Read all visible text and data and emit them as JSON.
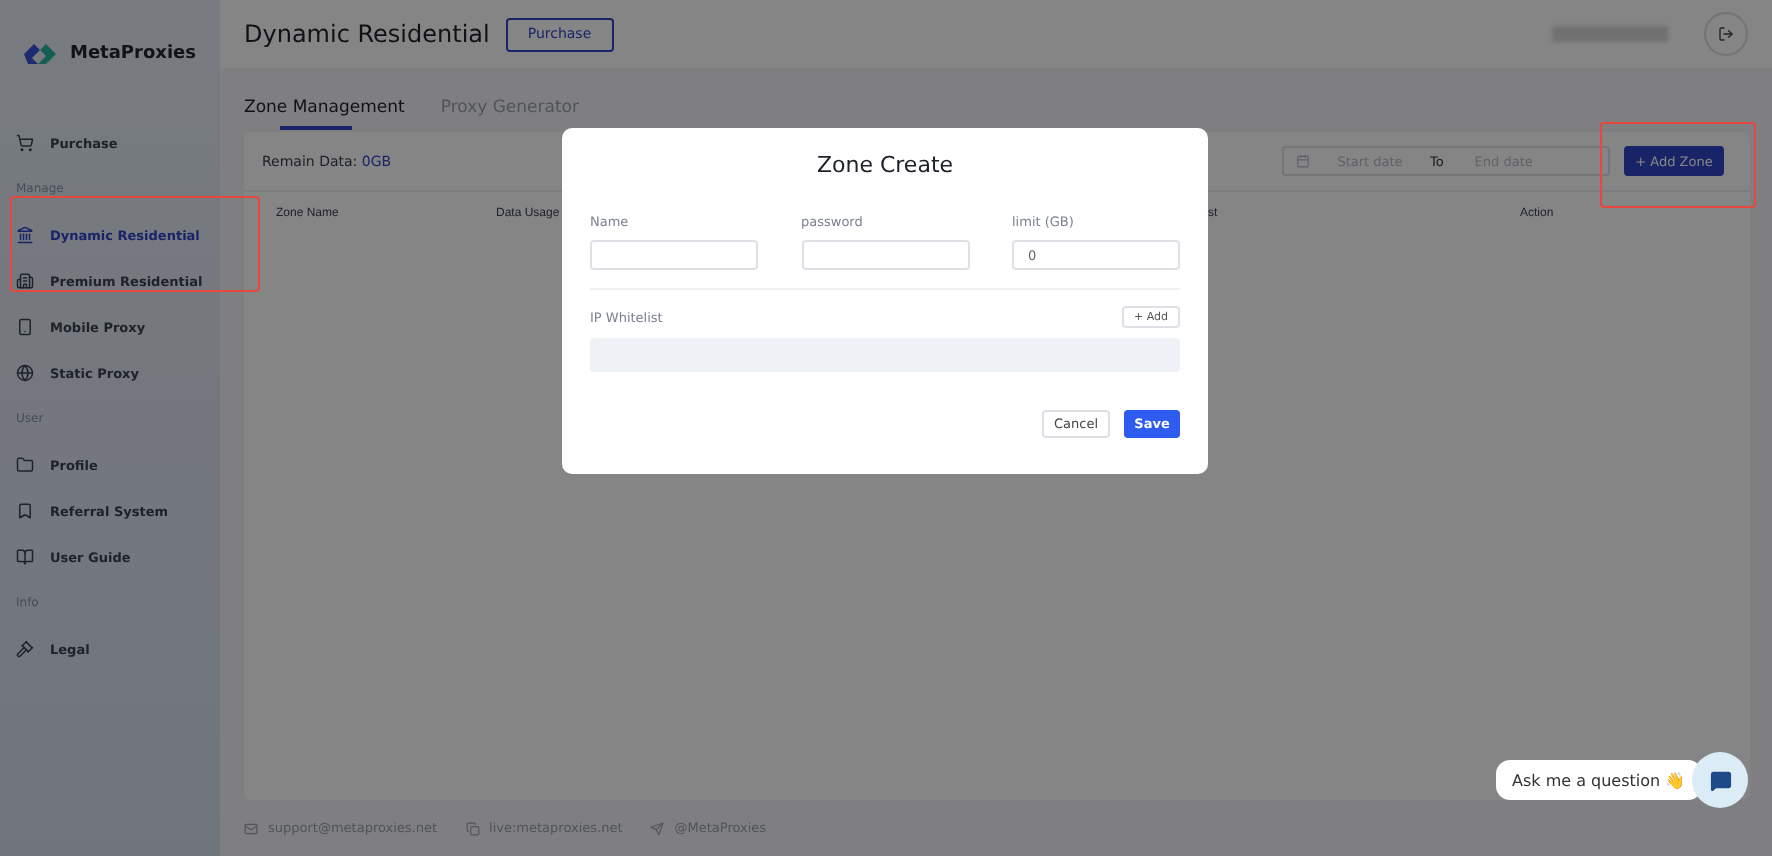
{
  "brand": "MetaProxies",
  "sidebar": [
    {
      "kind": "item",
      "label": "Purchase",
      "selected": false
    },
    {
      "kind": "heading",
      "label": "Manage"
    },
    {
      "kind": "item",
      "label": "Dynamic Residential",
      "selected": true
    },
    {
      "kind": "item",
      "label": "Premium Residential",
      "selected": false
    },
    {
      "kind": "item",
      "label": "Mobile Proxy",
      "selected": false
    },
    {
      "kind": "item",
      "label": "Static Proxy",
      "selected": false
    },
    {
      "kind": "heading",
      "label": "User"
    },
    {
      "kind": "item",
      "label": "Profile",
      "selected": false
    },
    {
      "kind": "item",
      "label": "Referral System",
      "selected": false
    },
    {
      "kind": "item",
      "label": "User Guide",
      "selected": false
    },
    {
      "kind": "heading",
      "label": "Info"
    },
    {
      "kind": "item",
      "label": "Legal",
      "selected": false
    }
  ],
  "header": {
    "title": "Dynamic Residential",
    "button": "Purchase"
  },
  "tabs": [
    {
      "label": "Zone Management",
      "selected": true
    },
    {
      "label": "Proxy Generator",
      "selected": false
    }
  ],
  "remain": {
    "label": "Remain Data:",
    "value": "0GB"
  },
  "date_range": {
    "start_placeholder": "Start date",
    "separator": "To",
    "end_placeholder": "End date"
  },
  "add_zone": "+ Add Zone",
  "table": {
    "columns": [
      "Zone Name",
      "Data Usage",
      "st",
      "Action"
    ]
  },
  "footer": [
    "support@metaproxies.net",
    "live:metaproxies.net",
    "@MetaProxies"
  ],
  "dialog": {
    "title": "Zone Create",
    "fields": [
      {
        "label": "Name"
      },
      {
        "label": "password"
      },
      {
        "label": "limit (GB)",
        "value": "0"
      }
    ],
    "whitelist_label": "IP Whitelist",
    "add_button": "+ Add",
    "cancel": "Cancel",
    "save": "Save"
  },
  "chat": {
    "prompt": "Ask me a question 👋"
  }
}
